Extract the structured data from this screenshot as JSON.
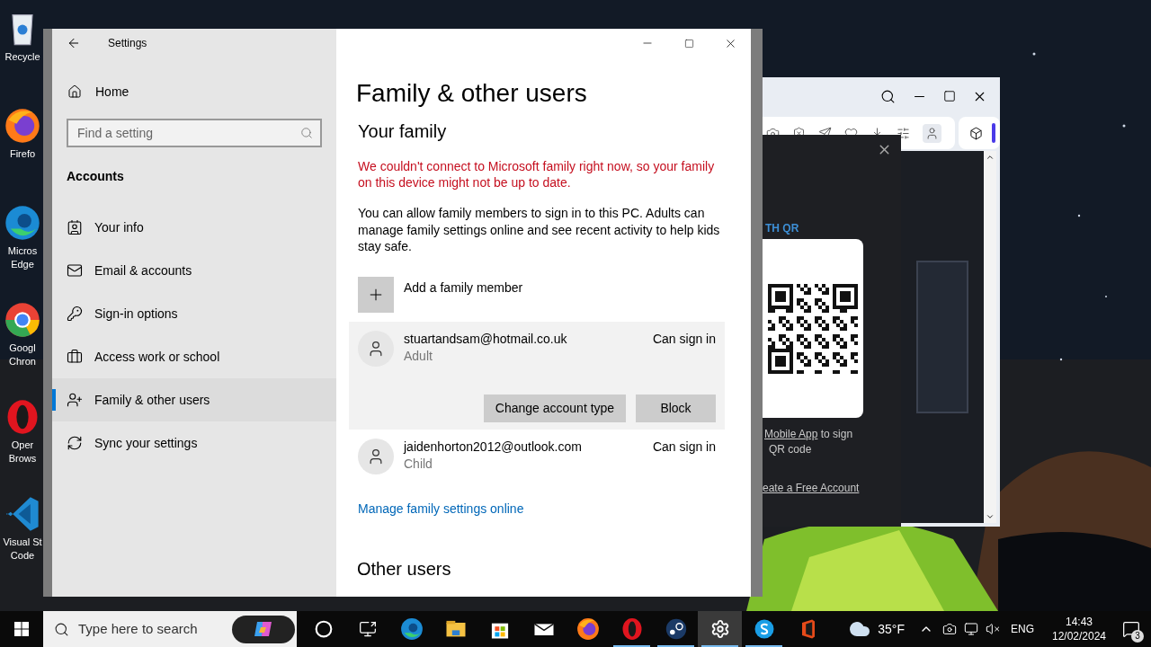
{
  "desktop_icons": [
    {
      "kind": "recycle",
      "label": [
        "Recycle"
      ]
    },
    {
      "kind": "firefox",
      "label": [
        "Firefo"
      ]
    },
    {
      "kind": "edge",
      "label": [
        "Micros",
        "Edge"
      ]
    },
    {
      "kind": "chrome",
      "label": [
        "Googl",
        "Chron"
      ]
    },
    {
      "kind": "opera",
      "label": [
        "Oper",
        "Brows"
      ]
    },
    {
      "kind": "vscode",
      "label": [
        "Visual St",
        "Code"
      ]
    }
  ],
  "settings": {
    "title": "Settings",
    "home": "Home",
    "search": {
      "placeholder": "Find a setting"
    },
    "section": "Accounts",
    "nav": [
      {
        "kind": "info",
        "label": "Your info",
        "selected": false
      },
      {
        "kind": "mail",
        "label": "Email & accounts",
        "selected": false
      },
      {
        "kind": "key",
        "label": "Sign-in options",
        "selected": false
      },
      {
        "kind": "briefcase",
        "label": "Access work or school",
        "selected": false
      },
      {
        "kind": "family",
        "label": "Family & other users",
        "selected": true
      },
      {
        "kind": "sync",
        "label": "Sync your settings",
        "selected": false
      }
    ],
    "page_title": "Family & other users",
    "your_family": {
      "heading": "Your family",
      "error": "We couldn't connect to Microsoft family right now, so your family on this device might not be up to date.",
      "description": "You can allow family members to sign in to this PC. Adults can manage family settings online and see recent activity to help kids stay safe.",
      "add_label": "Add a family member",
      "members": [
        {
          "email": "stuartandsam@hotmail.co.uk",
          "role": "Adult",
          "status": "Can sign in",
          "expanded": true,
          "actions": [
            "Change account type",
            "Block"
          ]
        },
        {
          "email": "jaidenhorton2012@outlook.com",
          "role": "Child",
          "status": "Can sign in",
          "expanded": false
        }
      ],
      "manage_link": "Manage family settings online"
    },
    "other_users_heading": "Other users"
  },
  "browser": {
    "heading": "TH QR",
    "link": "Mobile App",
    "text_after": " to sign",
    "line2": "QR code",
    "signup_link": "eate a Free Account"
  },
  "taskbar": {
    "search_placeholder": "Type here to search",
    "apps": [
      {
        "kind": "cortana",
        "running": false,
        "active": false
      },
      {
        "kind": "taskview",
        "running": false,
        "active": false
      },
      {
        "kind": "edge",
        "running": false,
        "active": false
      },
      {
        "kind": "explorer",
        "running": false,
        "active": false
      },
      {
        "kind": "store",
        "running": false,
        "active": false
      },
      {
        "kind": "mail",
        "running": false,
        "active": false
      },
      {
        "kind": "firefox",
        "running": false,
        "active": false
      },
      {
        "kind": "opera",
        "running": true,
        "active": false
      },
      {
        "kind": "steam",
        "running": true,
        "active": false
      },
      {
        "kind": "settings",
        "running": true,
        "active": true
      },
      {
        "kind": "skype",
        "running": true,
        "active": false
      },
      {
        "kind": "office",
        "running": false,
        "active": false
      }
    ],
    "weather": "35°F",
    "language": "ENG",
    "time": "14:43",
    "date": "12/02/2024",
    "notifications": "3"
  }
}
